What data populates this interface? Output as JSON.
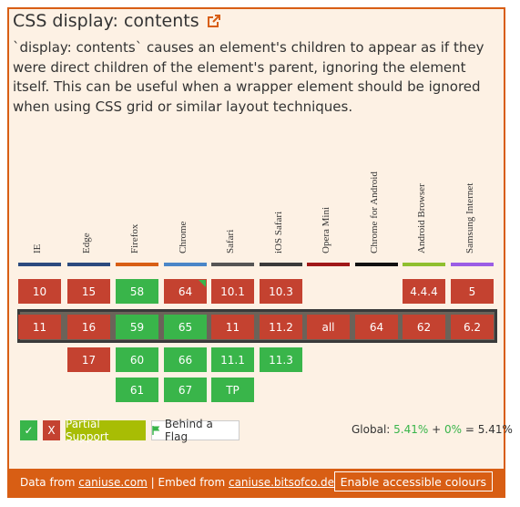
{
  "title": "CSS display: contents",
  "description": "`display: contents` causes an element's children to appear as if they were direct children of the element's parent, ignoring the element itself. This can be useful when a wrapper element should be ignored when using CSS grid or similar layout techniques.",
  "browsers": [
    {
      "name": "IE",
      "bar_color": "#2b4a7e",
      "past": "10",
      "current": "11",
      "future": [
        "",
        ""
      ]
    },
    {
      "name": "Edge",
      "bar_color": "#2b4a7e",
      "past": "15",
      "current": "16",
      "future": [
        "17",
        ""
      ]
    },
    {
      "name": "Firefox",
      "bar_color": "#d85e14",
      "past": "58",
      "current": "59",
      "future": [
        "60",
        "61"
      ]
    },
    {
      "name": "Chrome",
      "bar_color": "#4a86c8",
      "past": "64",
      "current": "65",
      "future": [
        "66",
        "67"
      ]
    },
    {
      "name": "Safari",
      "bar_color": "#555555",
      "past": "10.1",
      "current": "11",
      "future": [
        "11.1",
        "TP"
      ]
    },
    {
      "name": "iOS Safari",
      "bar_color": "#3a3a3a",
      "past": "10.3",
      "current": "11.2",
      "future": [
        "11.3",
        ""
      ]
    },
    {
      "name": "Opera Mini",
      "bar_color": "#a01818",
      "past": "",
      "current": "all",
      "future": [
        "",
        ""
      ]
    },
    {
      "name": "Chrome for Android",
      "bar_color": "#111111",
      "past": "",
      "current": "64",
      "future": [
        "",
        ""
      ]
    },
    {
      "name": "Android Browser",
      "bar_color": "#8fbf2f",
      "past": "4.4.4",
      "current": "62",
      "future": [
        "",
        ""
      ]
    },
    {
      "name": "Samsung Internet",
      "bar_color": "#9b5de5",
      "past": "5",
      "current": "6.2",
      "future": [
        "",
        ""
      ]
    }
  ],
  "support_status": {
    "past": [
      "no",
      "no",
      "yes",
      "no-flag",
      "no",
      "no",
      "",
      "",
      "no",
      "no"
    ],
    "current": [
      "no",
      "no",
      "yes",
      "yes",
      "no",
      "no",
      "no",
      "no",
      "no",
      "no"
    ],
    "future1": [
      "",
      "no",
      "yes",
      "yes",
      "yes",
      "yes",
      "",
      "",
      "",
      ""
    ],
    "future2": [
      "",
      "",
      "yes",
      "yes",
      "yes",
      "",
      "",
      "",
      "",
      ""
    ]
  },
  "legend": {
    "yes_symbol": "✓",
    "no_symbol": "X",
    "partial": "Partial Support",
    "flag": "Behind a Flag"
  },
  "global": {
    "label": "Global:",
    "supported": "5.41%",
    "plus": "+",
    "partial": "0%",
    "equals": "=",
    "total": "5.41%"
  },
  "footer": {
    "data_from": "Data from",
    "caniuse": "caniuse.com",
    "separator": "|",
    "embed_from": "Embed from",
    "embed_link": "caniuse.bitsofco.de",
    "button": "Enable accessible colours"
  },
  "colors": {
    "accent": "#d85e14",
    "supported": "#39b54a",
    "unsupported": "#c44230",
    "partial": "#a8bd04"
  }
}
